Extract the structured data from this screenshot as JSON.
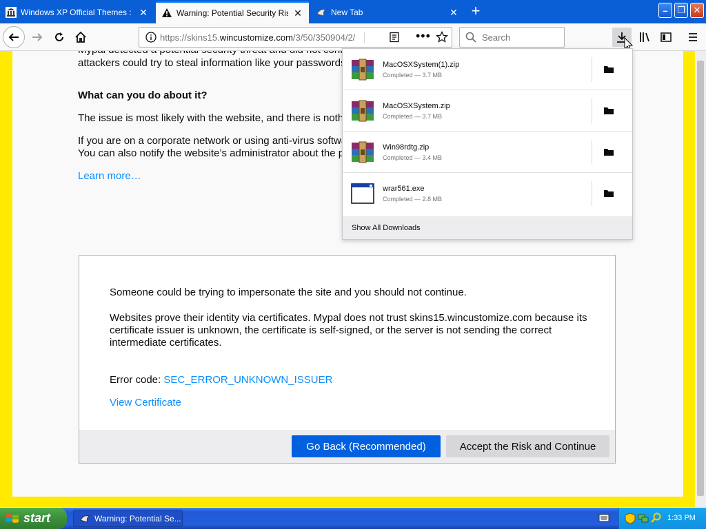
{
  "browser": {
    "tabs": [
      {
        "title": "Windows XP Official Themes : Micr",
        "active": false
      },
      {
        "title": "Warning: Potential Security Risk A",
        "active": true
      },
      {
        "title": "New Tab",
        "active": false
      }
    ],
    "url_prefix": "https://skins15.",
    "url_host": "wincustomize.com",
    "url_path": "/3/50/350904/2/",
    "search_placeholder": "Search"
  },
  "page": {
    "partial_line_1": "Mypal detected a potential security threat and did not continue to skins15.wincustomize.com. If you visit this site,",
    "partial_line_2": "attackers could try to steal information like your passwords, emails, or credit card details.",
    "heading_what_can_you_do": "What can you do about it?",
    "para_issue": "The issue is most likely with the website, and there is nothing you can do to resolve it.",
    "para_corporate_1": "If you are on a corporate network or using anti-virus software, you can reach out to the support teams for assistance.",
    "para_corporate_2": "You can also notify the website’s administrator about the problem.",
    "learn_more": "Learn more…",
    "details": {
      "impersonate": "Someone could be trying to impersonate the site and you should not continue.",
      "certificates_1": "Websites prove their identity via certificates. Mypal does not trust skins15.wincustomize.com because its",
      "certificates_2": "certificate issuer is unknown, the certificate is self-signed, or the server is not sending the correct",
      "certificates_3": "intermediate certificates.",
      "error_code_label": "Error code:",
      "error_code": "SEC_ERROR_UNKNOWN_ISSUER",
      "view_certificate": "View Certificate",
      "go_back": "Go Back (Recommended)",
      "accept_risk": "Accept the Risk and Continue"
    }
  },
  "downloads": {
    "items": [
      {
        "name": "MacOSXSystem(1).zip",
        "status": "Completed — 3.7 MB",
        "icon": "winrar-archive-icon"
      },
      {
        "name": "MacOSXSystem.zip",
        "status": "Completed — 3.7 MB",
        "icon": "winrar-archive-icon"
      },
      {
        "name": "Win98rdtg.zip",
        "status": "Completed — 3.4 MB",
        "icon": "winrar-archive-icon"
      },
      {
        "name": "wrar561.exe",
        "status": "Completed — 2.8 MB",
        "icon": "executable-window-icon"
      }
    ],
    "show_all": "Show All Downloads"
  },
  "taskbar": {
    "start_label": "start",
    "task_title": "Warning: Potential Se...",
    "clock": "1:33 PM"
  },
  "colors": {
    "accent": "#0060df",
    "link": "#0a8dff",
    "page_border": "#ffea00",
    "tabstrip": "#0a5fd6"
  }
}
